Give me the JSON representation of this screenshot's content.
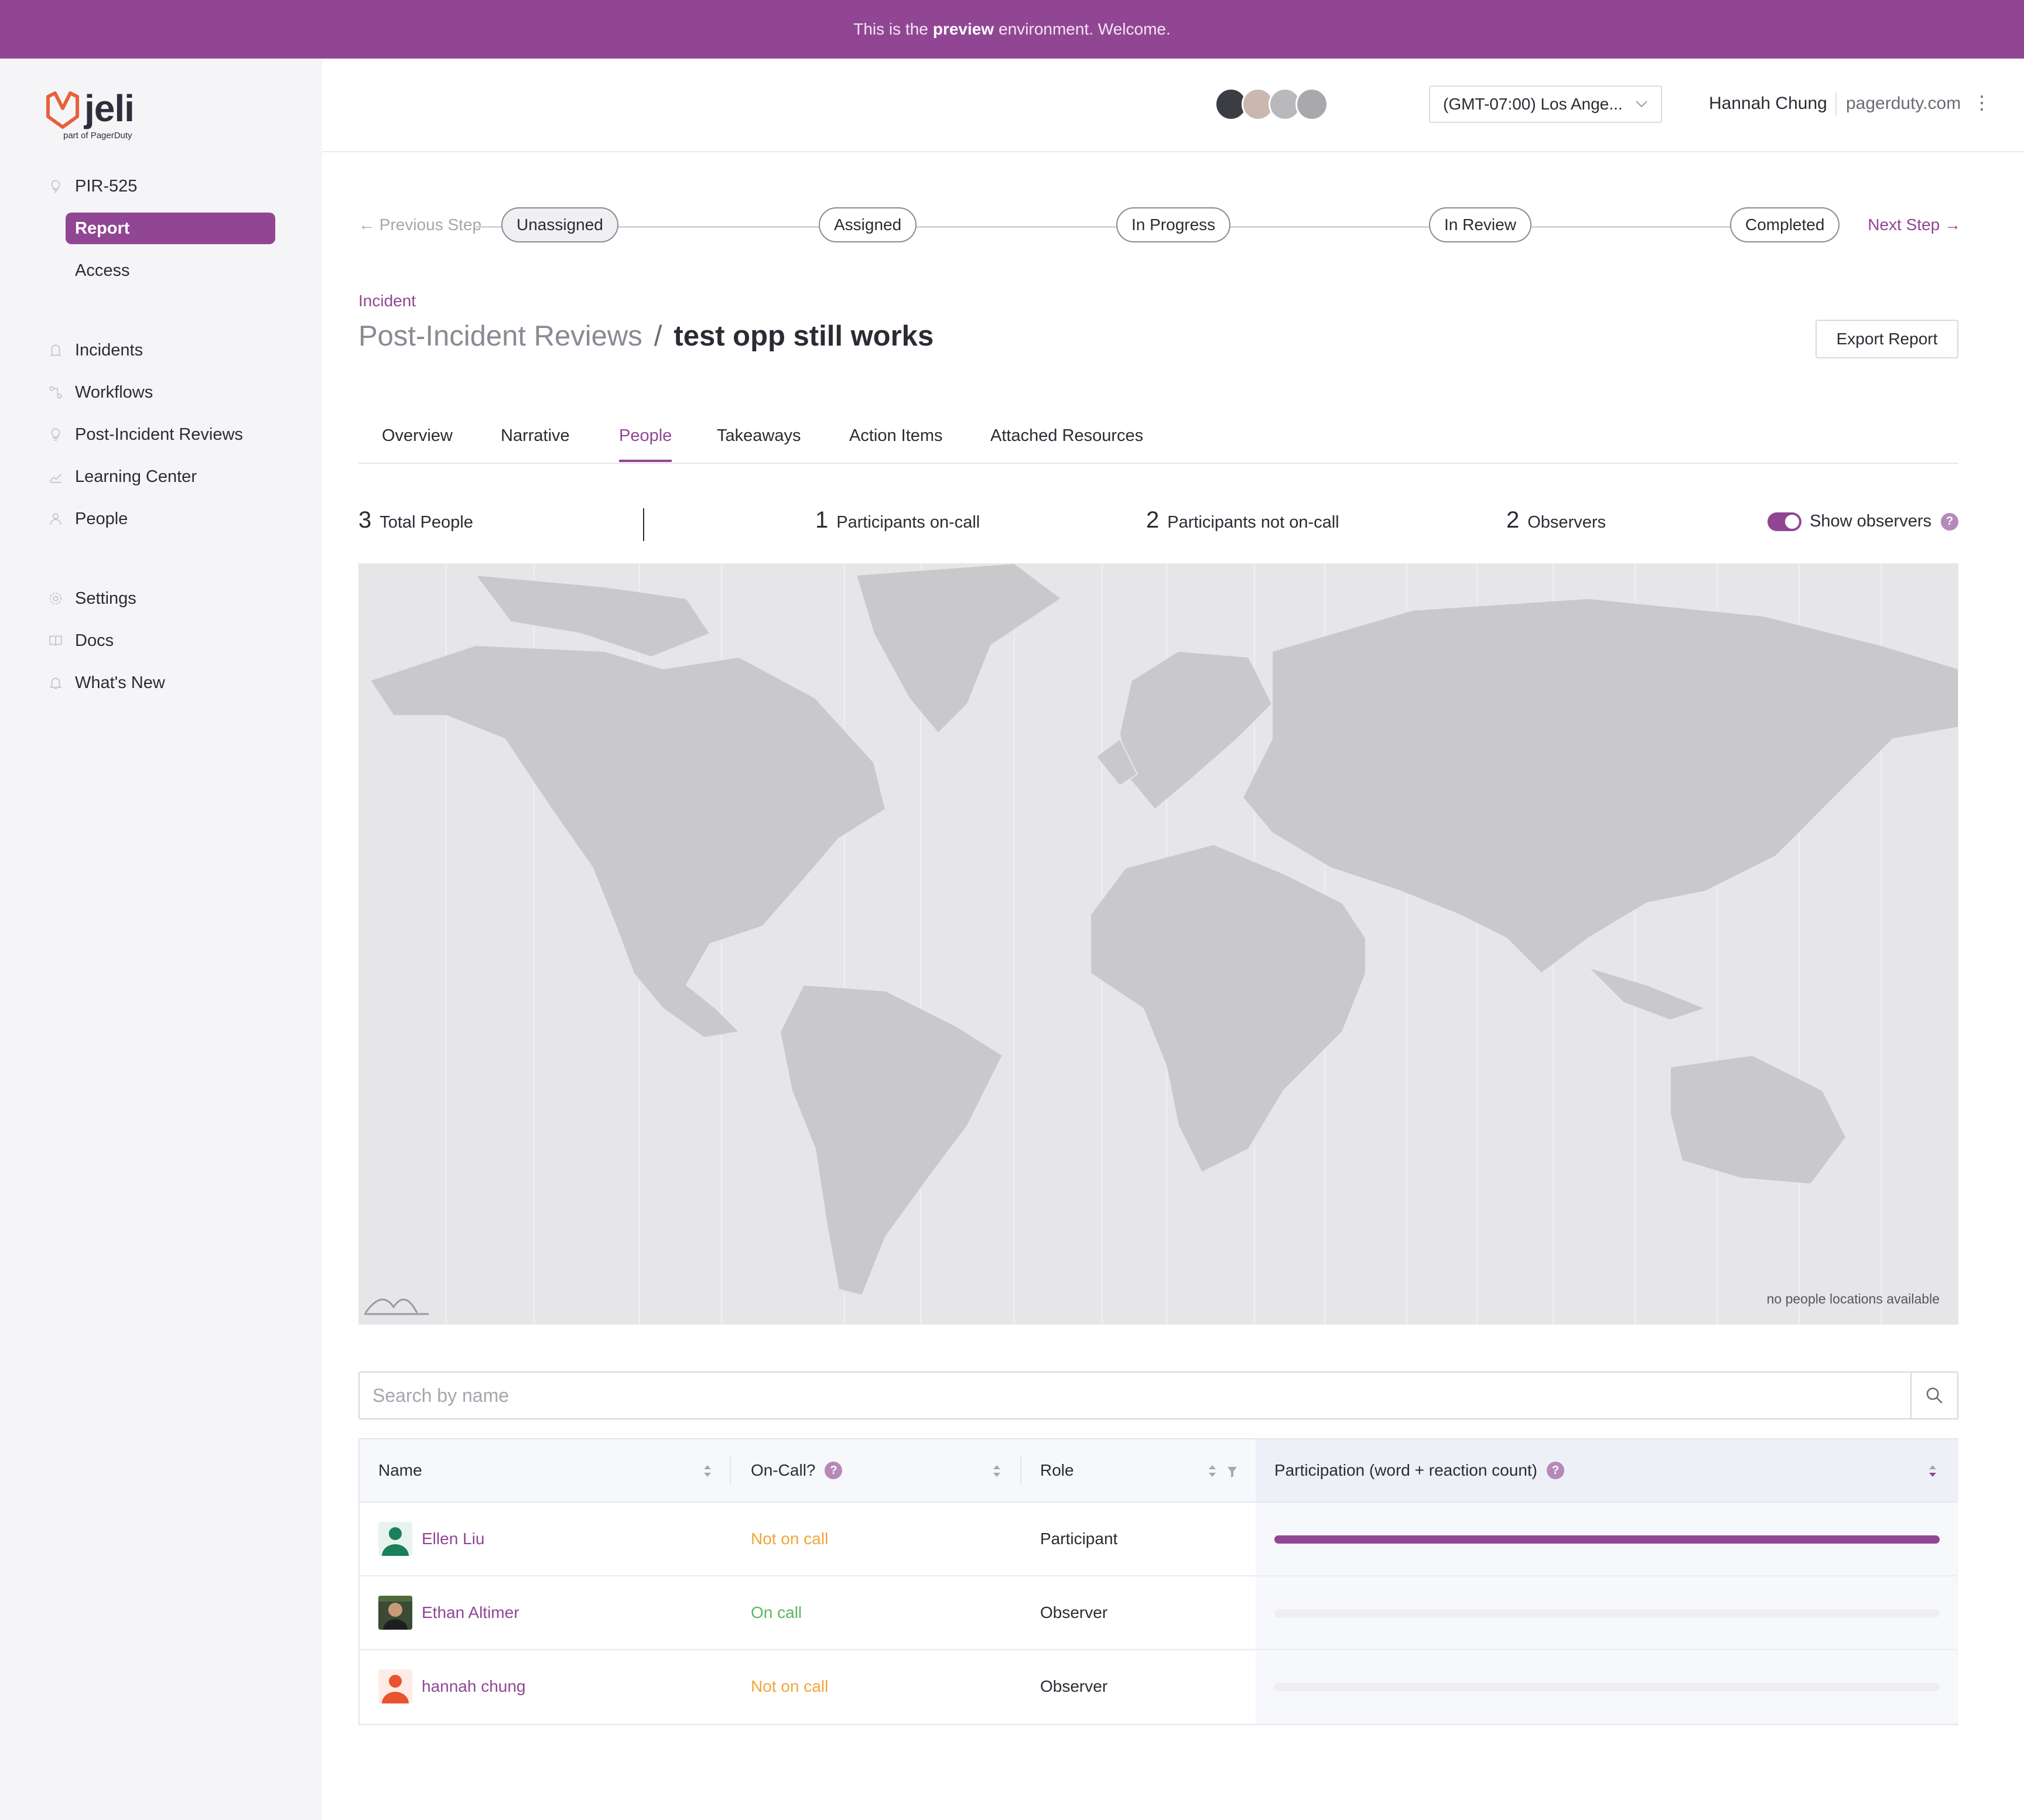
{
  "banner": {
    "prefix": "This is the",
    "bold": "preview",
    "suffix": "environment. Welcome."
  },
  "logo": {
    "name": "jeli",
    "sub": "part of PagerDuty"
  },
  "sidebar": {
    "pir": {
      "label": "PIR-525",
      "icon": "lightbulb-icon"
    },
    "sub_items": [
      {
        "label": "Report",
        "active": true
      },
      {
        "label": "Access",
        "active": false
      }
    ],
    "nav": [
      {
        "label": "Incidents",
        "icon": "incident-icon"
      },
      {
        "label": "Workflows",
        "icon": "workflow-icon"
      },
      {
        "label": "Post-Incident Reviews",
        "icon": "lightbulb-icon"
      },
      {
        "label": "Learning Center",
        "icon": "chart-line-icon"
      },
      {
        "label": "People",
        "icon": "person-icon"
      }
    ],
    "bottom": [
      {
        "label": "Settings",
        "icon": "gear-icon"
      },
      {
        "label": "Docs",
        "icon": "book-icon"
      },
      {
        "label": "What's New",
        "icon": "bell-icon"
      }
    ]
  },
  "topbar": {
    "timezone": "(GMT-07:00) Los Ange...",
    "user_name": "Hannah Chung",
    "user_domain": "pagerduty.com"
  },
  "stepper": {
    "prev": "Previous Step",
    "next": "Next Step",
    "steps": [
      "Unassigned",
      "Assigned",
      "In Progress",
      "In Review",
      "Completed"
    ],
    "current": "Unassigned"
  },
  "header": {
    "crumb": "Incident",
    "parent": "Post-Incident Reviews",
    "slash": "/",
    "title": "test opp still works",
    "export": "Export Report"
  },
  "tabs": [
    "Overview",
    "Narrative",
    "People",
    "Takeaways",
    "Action Items",
    "Attached Resources"
  ],
  "active_tab": "People",
  "stats": {
    "total": {
      "num": "3",
      "label": "Total People"
    },
    "oncall": {
      "num": "1",
      "label": "Participants on-call"
    },
    "not_oncall": {
      "num": "2",
      "label": "Participants not on-call"
    },
    "observers": {
      "num": "2",
      "label": "Observers"
    },
    "toggle_label": "Show observers",
    "toggle_on": true
  },
  "map": {
    "note": "no people locations available"
  },
  "search": {
    "placeholder": "Search by name"
  },
  "table": {
    "headers": {
      "name": "Name",
      "oncall": "On-Call?",
      "role": "Role",
      "participation": "Participation (word + reaction count)"
    },
    "rows": [
      {
        "name": "Ellen Liu",
        "oncall": "Not on call",
        "oncall_status": "no",
        "role": "Participant",
        "participation": 1.0,
        "avatar_color": "#1a7f5a"
      },
      {
        "name": "Ethan Altimer",
        "oncall": "On call",
        "oncall_status": "yes",
        "role": "Observer",
        "participation": 0.0,
        "avatar_color": "#2f3a2a"
      },
      {
        "name": "hannah chung",
        "oncall": "Not on call",
        "oncall_status": "no",
        "role": "Observer",
        "participation": 0.0,
        "avatar_color": "#e8542f"
      }
    ]
  },
  "colors": {
    "brand": "#914693",
    "not_on_call": "#f0a53a",
    "on_call": "#5cb85c"
  }
}
